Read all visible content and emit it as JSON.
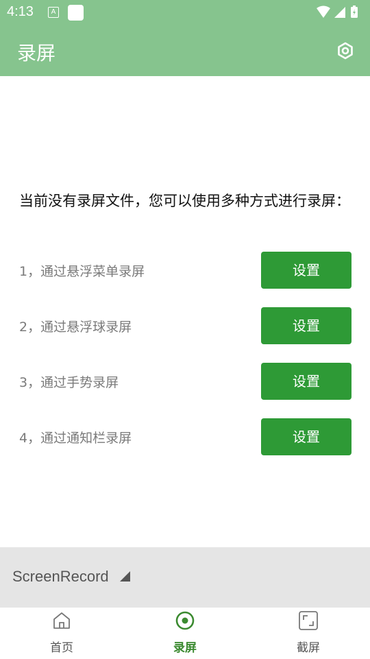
{
  "status_bar": {
    "time": "4:13",
    "notification_icon": "A"
  },
  "app_bar": {
    "title": "录屏",
    "settings_icon": "settings-icon"
  },
  "content": {
    "intro_text": "当前没有录屏文件，您可以使用多种方式进行录屏：",
    "methods": [
      {
        "label": "1，通过悬浮菜单录屏",
        "button": "设置"
      },
      {
        "label": "2，通过悬浮球录屏",
        "button": "设置"
      },
      {
        "label": "3，通过手势录屏",
        "button": "设置"
      },
      {
        "label": "4，通过通知栏录屏",
        "button": "设置"
      }
    ]
  },
  "record_bar": {
    "label": "ScreenRecord"
  },
  "bottom_nav": {
    "items": [
      {
        "label": "首页",
        "icon": "home-icon",
        "active": false
      },
      {
        "label": "录屏",
        "icon": "record-icon",
        "active": true
      },
      {
        "label": "截屏",
        "icon": "screenshot-icon",
        "active": false
      }
    ]
  },
  "colors": {
    "primary_light": "#86c48e",
    "button_green": "#2e9a36",
    "active_nav": "#3b8a30"
  }
}
